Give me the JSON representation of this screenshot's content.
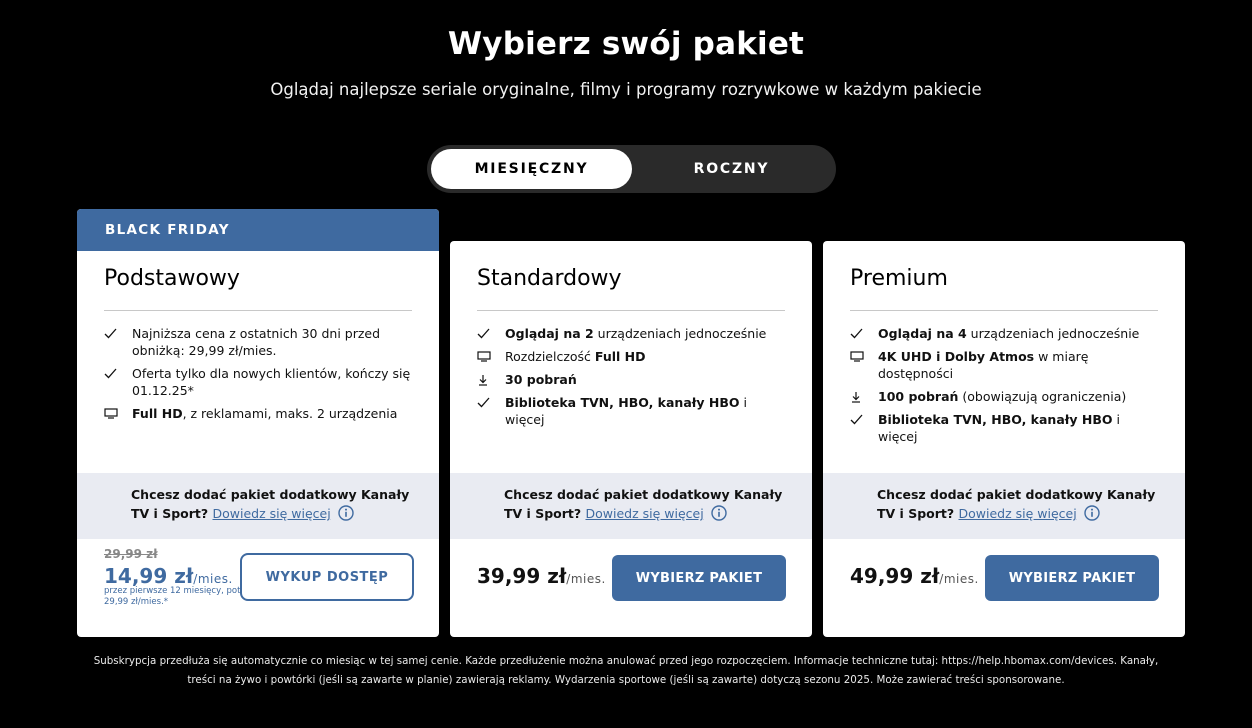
{
  "header": {
    "title": "Wybierz swój pakiet",
    "subtitle": "Oglądaj najlepsze seriale oryginalne, filmy i programy rozrywkowe w każdym pakiecie"
  },
  "billing_toggle": {
    "options": [
      "MIESIĘCZNY",
      "ROCZNY"
    ],
    "selected": "MIESIĘCZNY"
  },
  "plans": [
    {
      "banner": "BLACK FRIDAY",
      "name": "Podstawowy",
      "features": [
        {
          "icon": "check-icon",
          "text": "Najniższa cena z ostatnich 30 dni przed obniżką: 29,99 zł/mies."
        },
        {
          "icon": "check-icon",
          "text": "Oferta tylko dla nowych klientów, kończy się 01.12.25*"
        },
        {
          "icon": "tv-icon",
          "bold": "Full HD",
          "text": ", z reklamami, maks. 2 urządzenia"
        }
      ],
      "addon_text": "Chcesz dodać pakiet dodatkowy Kanały TV i Sport?",
      "addon_link": "Dowiedz się więcej",
      "old_price": "29,99 zł",
      "price": "14,99 zł",
      "per": "/mies.",
      "price_note": "przez pierwsze 12 miesięcy, potem 29,99 zł/mies.*",
      "button": "WYKUP DOSTĘP"
    },
    {
      "name": "Standardowy",
      "features": [
        {
          "icon": "check-icon",
          "bold": "Oglądaj na 2",
          "text": " urządzeniach jednocześnie"
        },
        {
          "icon": "tv-icon",
          "pre": "Rozdzielczość ",
          "bold": "Full HD",
          "text": ""
        },
        {
          "icon": "download-icon",
          "bold": "30 pobrań",
          "text": ""
        },
        {
          "icon": "check-icon",
          "bold": "Biblioteka TVN, HBO, kanały HBO",
          "text": " i więcej"
        }
      ],
      "addon_text": "Chcesz dodać pakiet dodatkowy Kanały TV i Sport?",
      "addon_link": "Dowiedz się więcej",
      "price": "39,99 zł",
      "per": "/mies.",
      "button": "WYBIERZ PAKIET"
    },
    {
      "name": "Premium",
      "features": [
        {
          "icon": "check-icon",
          "bold": "Oglądaj na 4",
          "text": " urządzeniach jednocześnie"
        },
        {
          "icon": "tv-icon",
          "bold": "4K UHD i Dolby Atmos",
          "text": " w miarę dostępności"
        },
        {
          "icon": "download-icon",
          "bold": "100 pobrań",
          "text": " (obowiązują ograniczenia)"
        },
        {
          "icon": "check-icon",
          "bold": "Biblioteka TVN, HBO, kanały HBO",
          "text": " i więcej"
        }
      ],
      "addon_text": "Chcesz dodać pakiet dodatkowy Kanały TV i Sport?",
      "addon_link": "Dowiedz się więcej",
      "price": "49,99 zł",
      "per": "/mies.",
      "button": "WYBIERZ PAKIET"
    }
  ],
  "footer": {
    "line1": "Subskrypcja przedłuża się automatycznie co miesiąc w tej samej cenie. Każde przedłużenie można anulować przed jego rozpoczęciem. Informacje techniczne tutaj: https://help.hbomax.com/devices. Kanały,",
    "line2": "treści na żywo i powtórki (jeśli są zawarte w planie) zawierają reklamy. Wydarzenia sportowe (jeśli są zawarte) dotyczą sezonu 2025. Może zawierać treści sponsorowane."
  },
  "colors": {
    "accent": "#3f6aa0",
    "background": "#000000",
    "addon_bg": "#e9ebf2"
  }
}
